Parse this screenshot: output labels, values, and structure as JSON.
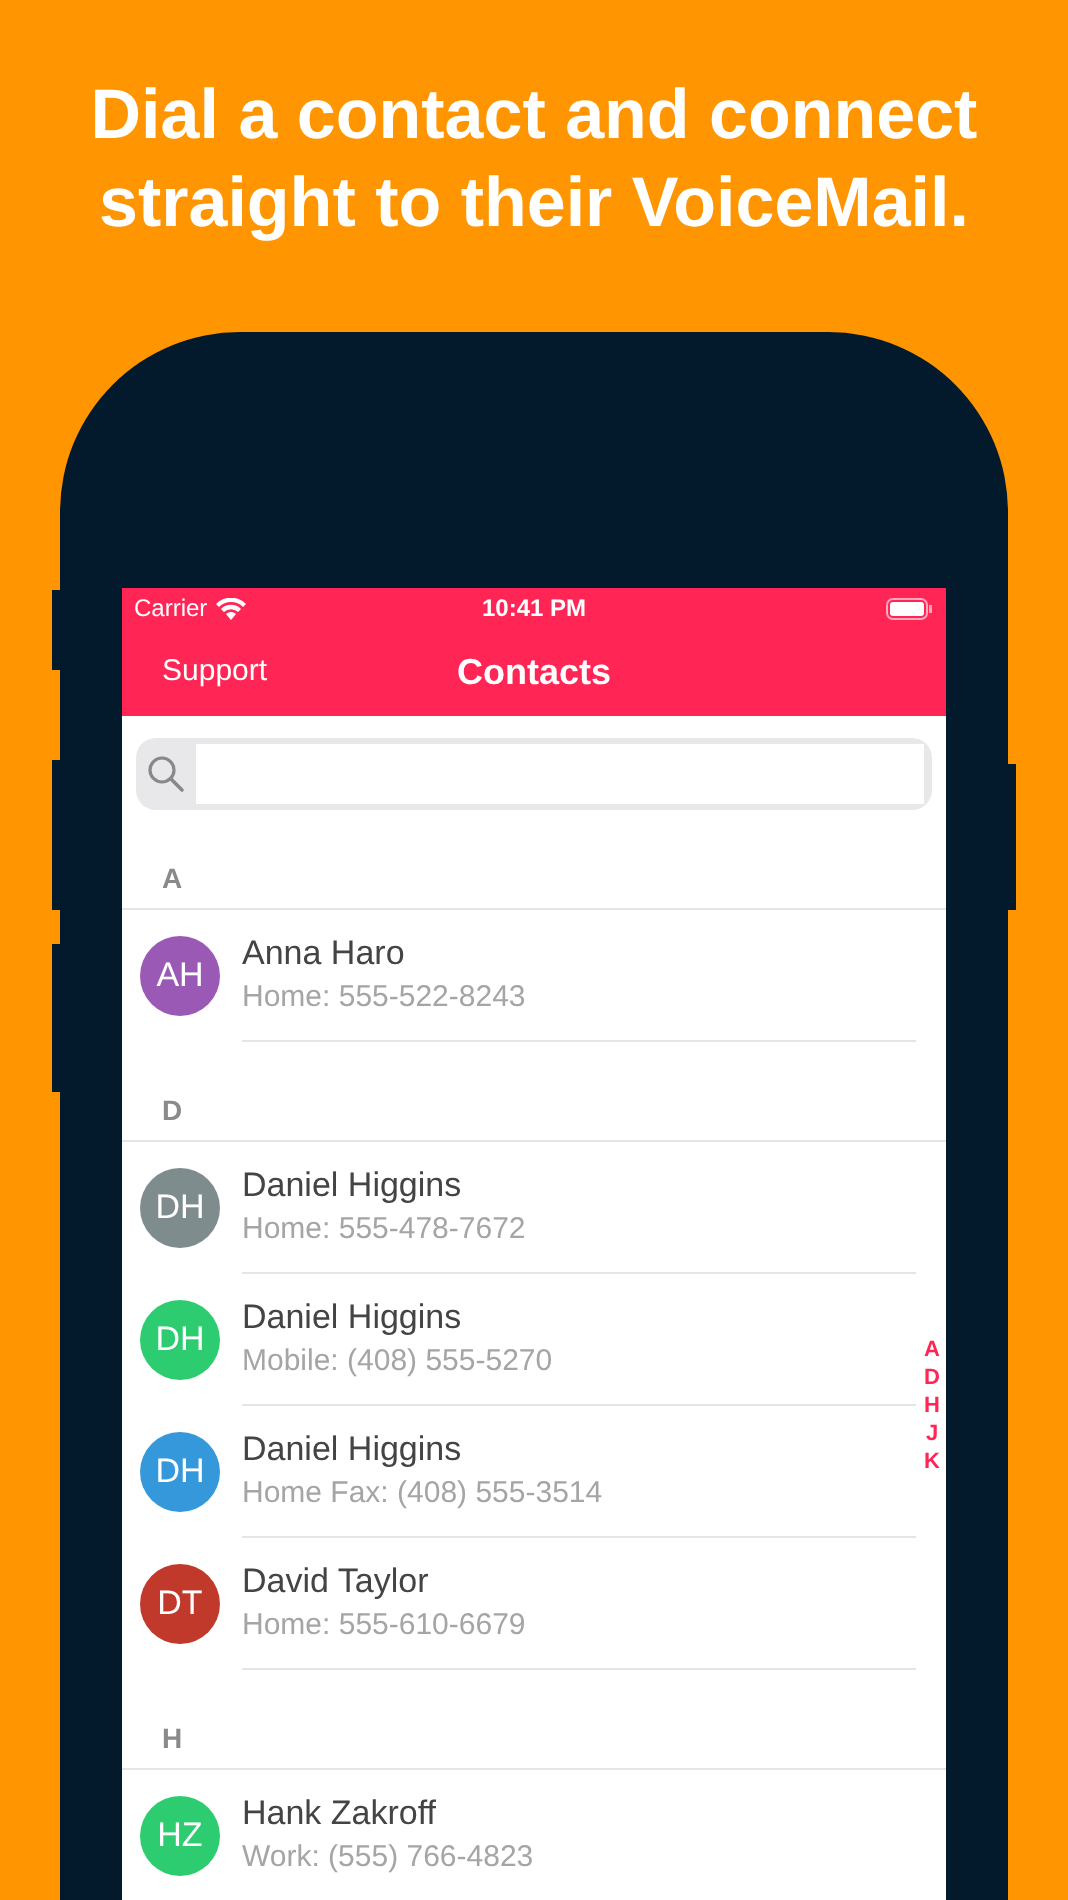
{
  "headline": "Dial a contact and connect straight to their VoiceMail.",
  "status_bar": {
    "carrier": "Carrier",
    "time": "10:41 PM"
  },
  "nav_bar": {
    "left_button": "Support",
    "title": "Contacts"
  },
  "sections": [
    {
      "letter": "A",
      "contacts": [
        {
          "initials": "AH",
          "color": "#9b59b6",
          "name": "Anna Haro",
          "phone": "Home: 555-522-8243"
        }
      ]
    },
    {
      "letter": "D",
      "contacts": [
        {
          "initials": "DH",
          "color": "#7f8c8d",
          "name": "Daniel Higgins",
          "phone": "Home: 555-478-7672"
        },
        {
          "initials": "DH",
          "color": "#2ecc71",
          "name": "Daniel Higgins",
          "phone": "Mobile: (408) 555-5270"
        },
        {
          "initials": "DH",
          "color": "#3498db",
          "name": "Daniel Higgins",
          "phone": "Home Fax: (408) 555-3514"
        },
        {
          "initials": "DT",
          "color": "#c0392b",
          "name": "David Taylor",
          "phone": "Home: 555-610-6679"
        }
      ]
    },
    {
      "letter": "H",
      "contacts": [
        {
          "initials": "HZ",
          "color": "#2ecc71",
          "name": "Hank Zakroff",
          "phone": "Work: (555) 766-4823"
        }
      ]
    }
  ],
  "index": [
    "A",
    "D",
    "H",
    "J",
    "K"
  ]
}
